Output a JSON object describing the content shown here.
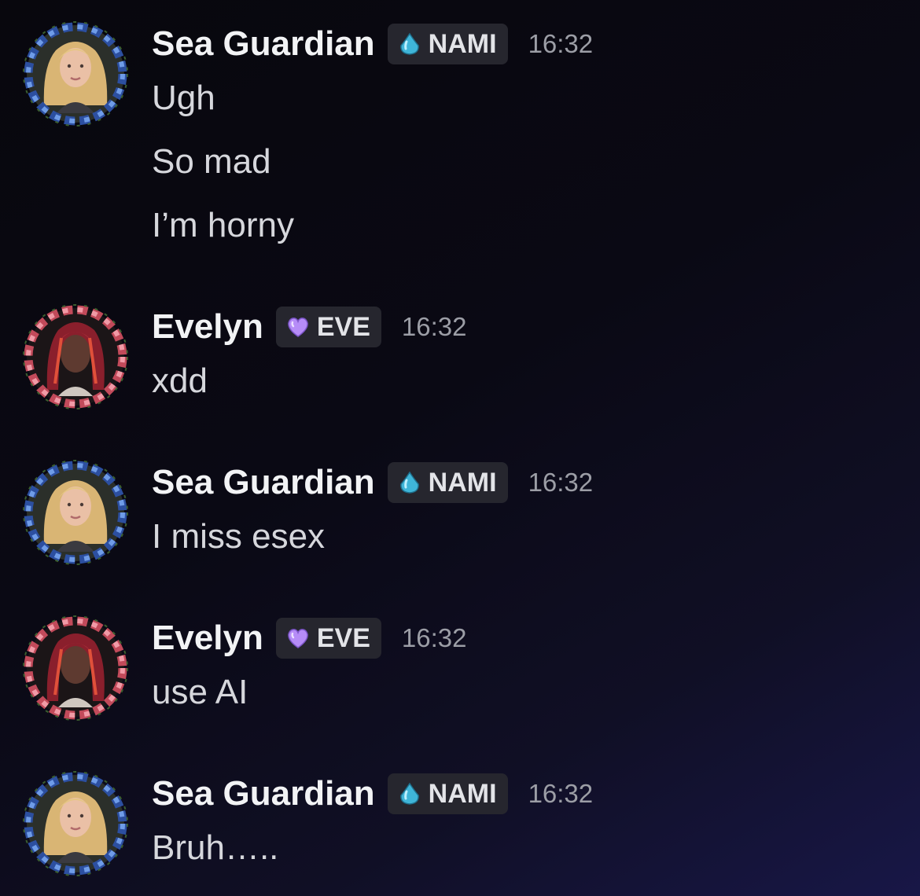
{
  "roles": {
    "nami": {
      "label": "NAMI",
      "icon": "water-drop-icon",
      "color": "#4fc3e0"
    },
    "eve": {
      "label": "EVE",
      "icon": "purple-heart-icon",
      "color": "#b389f5"
    }
  },
  "messages": [
    {
      "author": "Sea Guardian",
      "role": "NAMI",
      "time": "16:32",
      "lines": [
        "Ugh",
        "So mad",
        "I’m horny"
      ]
    },
    {
      "author": "Evelyn",
      "role": "EVE",
      "time": "16:32",
      "lines": [
        "xdd"
      ]
    },
    {
      "author": "Sea Guardian",
      "role": "NAMI",
      "time": "16:32",
      "lines": [
        "I miss esex"
      ]
    },
    {
      "author": "Evelyn",
      "role": "EVE",
      "time": "16:32",
      "lines": [
        "use AI"
      ]
    },
    {
      "author": "Sea Guardian",
      "role": "NAMI",
      "time": "16:32",
      "lines": [
        "Bruh….."
      ]
    }
  ]
}
